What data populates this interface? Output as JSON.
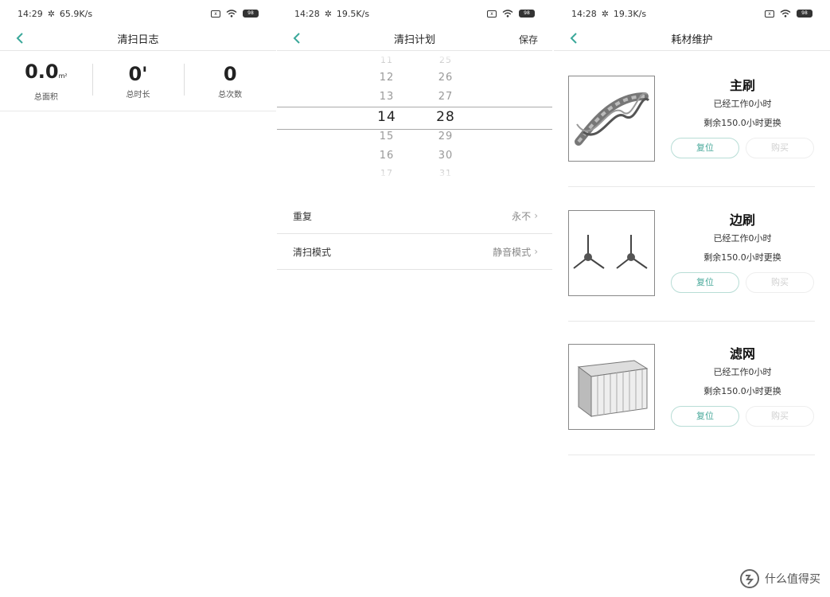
{
  "screens": {
    "log": {
      "status": {
        "time": "14:29",
        "speed": "65.9K/s",
        "battery": "98"
      },
      "title": "清扫日志",
      "stats": [
        {
          "value": "0.0",
          "unit": "m²",
          "label": "总面积"
        },
        {
          "value": "0'",
          "unit": "",
          "label": "总时长"
        },
        {
          "value": "0",
          "unit": "",
          "label": "总次数"
        }
      ]
    },
    "plan": {
      "status": {
        "time": "14:28",
        "speed": "19.5K/s",
        "battery": "98"
      },
      "title": "清扫计划",
      "save_label": "保存",
      "hours": [
        "11",
        "12",
        "13",
        "14",
        "15",
        "16",
        "17"
      ],
      "minutes": [
        "25",
        "26",
        "27",
        "28",
        "29",
        "30",
        "31"
      ],
      "selected_hour": "14",
      "selected_minute": "28",
      "settings": [
        {
          "label": "重复",
          "value": "永不"
        },
        {
          "label": "清扫模式",
          "value": "静音模式"
        }
      ]
    },
    "consumables": {
      "status": {
        "time": "14:28",
        "speed": "19.3K/s",
        "battery": "98"
      },
      "title": "耗材维护",
      "items": [
        {
          "name": "主刷",
          "worked": "已经工作0小时",
          "remaining": "剩余150.0小时更换",
          "reset_label": "复位",
          "buy_label": "购买",
          "image": "main-brush-image"
        },
        {
          "name": "边刷",
          "worked": "已经工作0小时",
          "remaining": "剩余150.0小时更换",
          "reset_label": "复位",
          "buy_label": "购买",
          "image": "side-brush-image"
        },
        {
          "name": "滤网",
          "worked": "已经工作0小时",
          "remaining": "剩余150.0小时更换",
          "reset_label": "复位",
          "buy_label": "购买",
          "image": "filter-image"
        }
      ]
    }
  },
  "watermark": {
    "text": "什么值得买"
  },
  "colors": {
    "accent": "#3aa89a",
    "back_arrow": "#3aa89a"
  }
}
